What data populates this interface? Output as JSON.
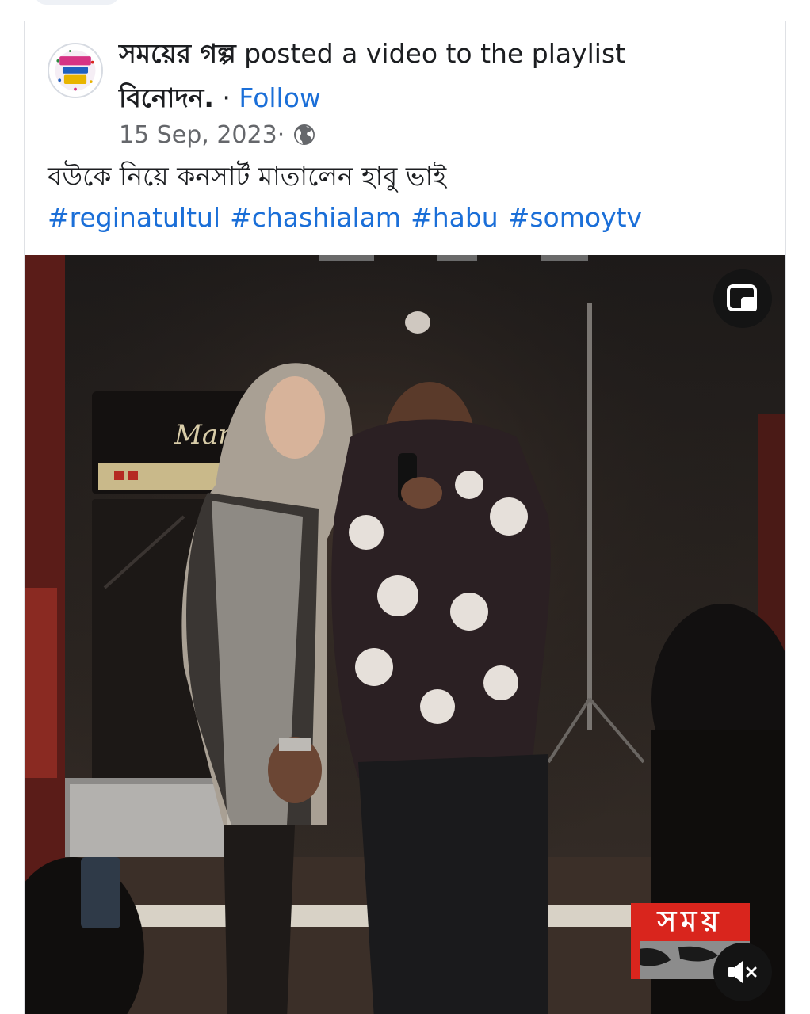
{
  "post": {
    "page_name": "সময়ের গল্প",
    "action_text": " posted a video to the playlist ",
    "playlist_name": "বিনোদন.",
    "separator": " · ",
    "follow_label": "Follow",
    "date": "15 Sep, 2023",
    "date_separator": " ·",
    "audience_icon": "globe-icon",
    "caption": "বউকে নিয়ে কনসার্ট মাতালেন হাবু ভাই",
    "hashtags": [
      "#reginatultul",
      "#chashialam",
      "#habu",
      "#somoytv"
    ]
  },
  "video": {
    "overlay_logo_text": "সময়",
    "amp_brand_text": "Mar",
    "pip_icon": "picture-in-picture-icon",
    "mute_icon": "speaker-muted-icon"
  },
  "colors": {
    "link": "#1b6fd8",
    "text": "#1c1e21",
    "muted": "#65676b",
    "logo_red": "#d9251d"
  }
}
